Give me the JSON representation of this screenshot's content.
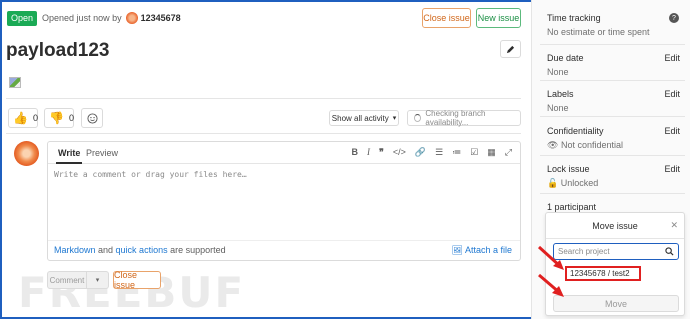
{
  "issue": {
    "status_badge": "Open",
    "opened_text": "Opened just now by",
    "author": "12345678",
    "title": "payload123",
    "close_issue_label": "Close issue",
    "new_issue_label": "New issue"
  },
  "reactions": {
    "thumbs_up_count": "0",
    "thumbs_down_count": "0"
  },
  "activity": {
    "show_all_label": "Show all activity",
    "checking_branch": "Checking branch availability..."
  },
  "editor": {
    "tab_write": "Write",
    "tab_preview": "Preview",
    "placeholder": "Write a comment or drag your files here…",
    "markdown_link": "Markdown",
    "and_text": " and ",
    "quick_actions_link": "quick actions",
    "supported_text": " are supported",
    "attach_label": "Attach a file",
    "toolbar_icons": [
      "bold-icon",
      "italic-icon",
      "quote-icon",
      "code-icon",
      "link-icon",
      "bullet-list-icon",
      "numbered-list-icon",
      "task-list-icon",
      "table-icon",
      "fullscreen-icon"
    ]
  },
  "actions": {
    "comment_label": "Comment",
    "close_issue_label": "Close issue"
  },
  "watermark": "FREEBUF",
  "sidebar": {
    "time_tracking": {
      "title": "Time tracking",
      "value": "No estimate or time spent"
    },
    "due_date": {
      "title": "Due date",
      "value": "None",
      "edit": "Edit"
    },
    "labels": {
      "title": "Labels",
      "value": "None",
      "edit": "Edit"
    },
    "confidentiality": {
      "title": "Confidentiality",
      "value": "Not confidential",
      "edit": "Edit"
    },
    "lock_issue": {
      "title": "Lock issue",
      "value": "Unlocked",
      "edit": "Edit"
    },
    "participants": "1 participant"
  },
  "move_issue": {
    "title": "Move issue",
    "search_placeholder": "Search project",
    "project": "12345678 / test2",
    "move_label": "Move"
  },
  "colors": {
    "open_badge": "#1aaa55",
    "close_border": "#e9a36a",
    "new_border": "#5cba7d",
    "link": "#1f78d1",
    "highlight": "#e02020"
  }
}
